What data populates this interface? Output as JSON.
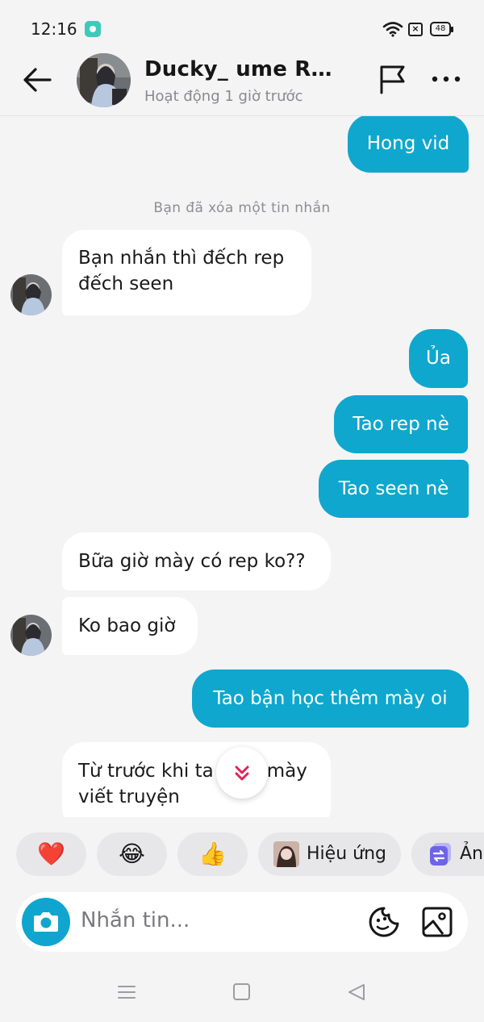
{
  "status_bar": {
    "time": "12:16",
    "battery": "48"
  },
  "header": {
    "contact_name": "Ducky_ ume Rhy...",
    "last_active": "Hoạt động 1 giờ trước"
  },
  "messages": [
    {
      "side": "out",
      "text": "Hong vid"
    },
    {
      "side": "notice",
      "text": "Bạn đã xóa một tin nhắn"
    },
    {
      "side": "in",
      "text_line1": "Bạn nhắn thì đếch rep",
      "text_line2": "đếch seen"
    },
    {
      "side": "out",
      "text": "Ủa"
    },
    {
      "side": "out",
      "text": "Tao rep nè"
    },
    {
      "side": "out",
      "text": "Tao seen nè"
    },
    {
      "side": "in",
      "text": "Bữa giờ mày có rep ko??"
    },
    {
      "side": "in",
      "text": "Ko bao giờ"
    },
    {
      "side": "out",
      "text": "Tao bận học thêm mày oi"
    },
    {
      "side": "in",
      "text_line1a": "Từ trước khi ta",
      "text_line1b": "mày",
      "text_line2": "viết truyện"
    }
  ],
  "quick_reactions": [
    {
      "emoji": "❤️"
    },
    {
      "emoji": "😂"
    },
    {
      "emoji": "👍"
    },
    {
      "label": "Hiệu ứng"
    },
    {
      "label": "Ản"
    }
  ],
  "composer": {
    "placeholder": "Nhắn tin..."
  },
  "colors": {
    "accent": "#0fa7cd",
    "incoming_bubble": "#ffffff",
    "background": "#f4f4f5"
  }
}
